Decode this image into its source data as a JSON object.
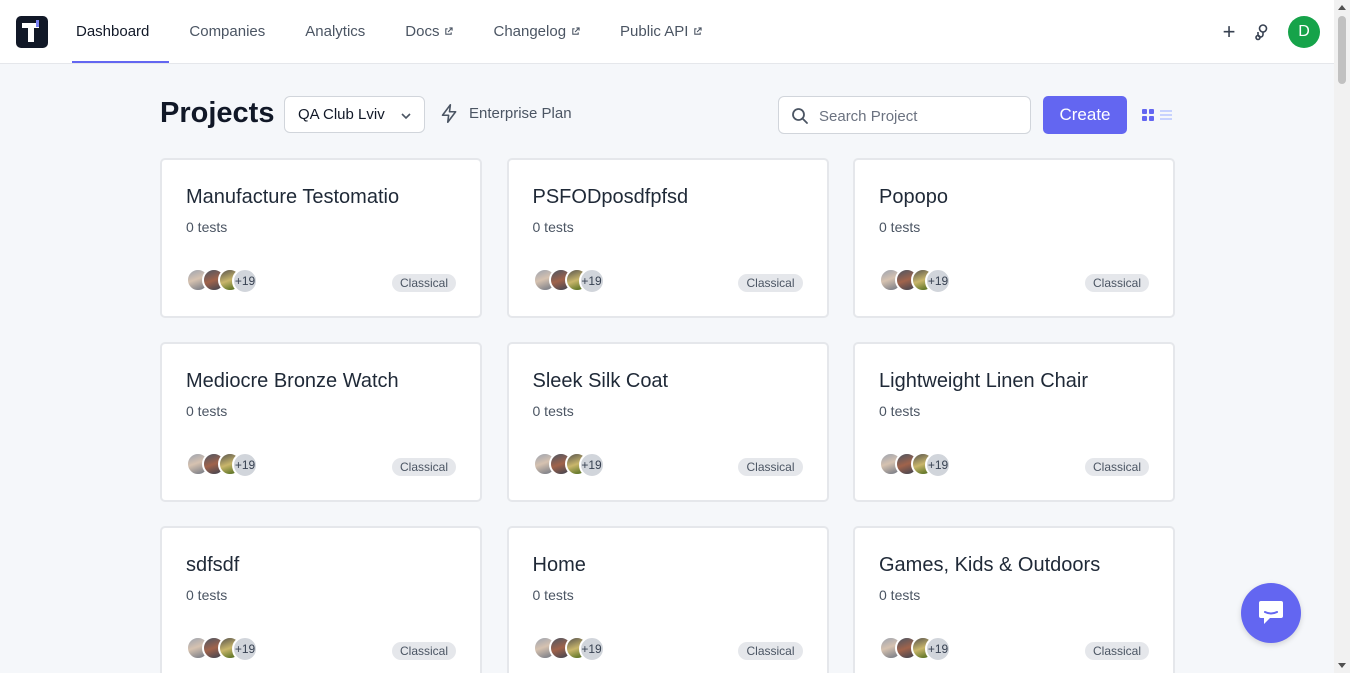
{
  "nav": {
    "links": [
      {
        "label": "Dashboard"
      },
      {
        "label": "Companies"
      },
      {
        "label": "Analytics"
      },
      {
        "label": "Docs"
      },
      {
        "label": "Changelog"
      },
      {
        "label": "Public API"
      }
    ],
    "active": "Dashboard",
    "user_initial": "D",
    "user_avatar_color": "#16a34a"
  },
  "header": {
    "title": "Projects",
    "company_selected": "QA Club Lviv",
    "plan_label": "Enterprise Plan",
    "search_placeholder": "Search Project",
    "create_label": "Create"
  },
  "accent_color": "#6366f1",
  "projects": [
    {
      "title": "Manufacture Testomatio",
      "tests": "0 tests",
      "members_more": "+19",
      "badge": "Classical"
    },
    {
      "title": "PSFODposdfpfsd",
      "tests": "0 tests",
      "members_more": "+19",
      "badge": "Classical"
    },
    {
      "title": "Popopo",
      "tests": "0 tests",
      "members_more": "+19",
      "badge": "Classical"
    },
    {
      "title": "Mediocre Bronze Watch",
      "tests": "0 tests",
      "members_more": "+19",
      "badge": "Classical"
    },
    {
      "title": "Sleek Silk Coat",
      "tests": "0 tests",
      "members_more": "+19",
      "badge": "Classical"
    },
    {
      "title": "Lightweight Linen Chair",
      "tests": "0 tests",
      "members_more": "+19",
      "badge": "Classical"
    },
    {
      "title": "sdfsdf",
      "tests": "0 tests",
      "members_more": "+19",
      "badge": "Classical"
    },
    {
      "title": "Home",
      "tests": "0 tests",
      "members_more": "+19",
      "badge": "Classical"
    },
    {
      "title": "Games, Kids & Outdoors",
      "tests": "0 tests",
      "members_more": "+19",
      "badge": "Classical"
    }
  ]
}
